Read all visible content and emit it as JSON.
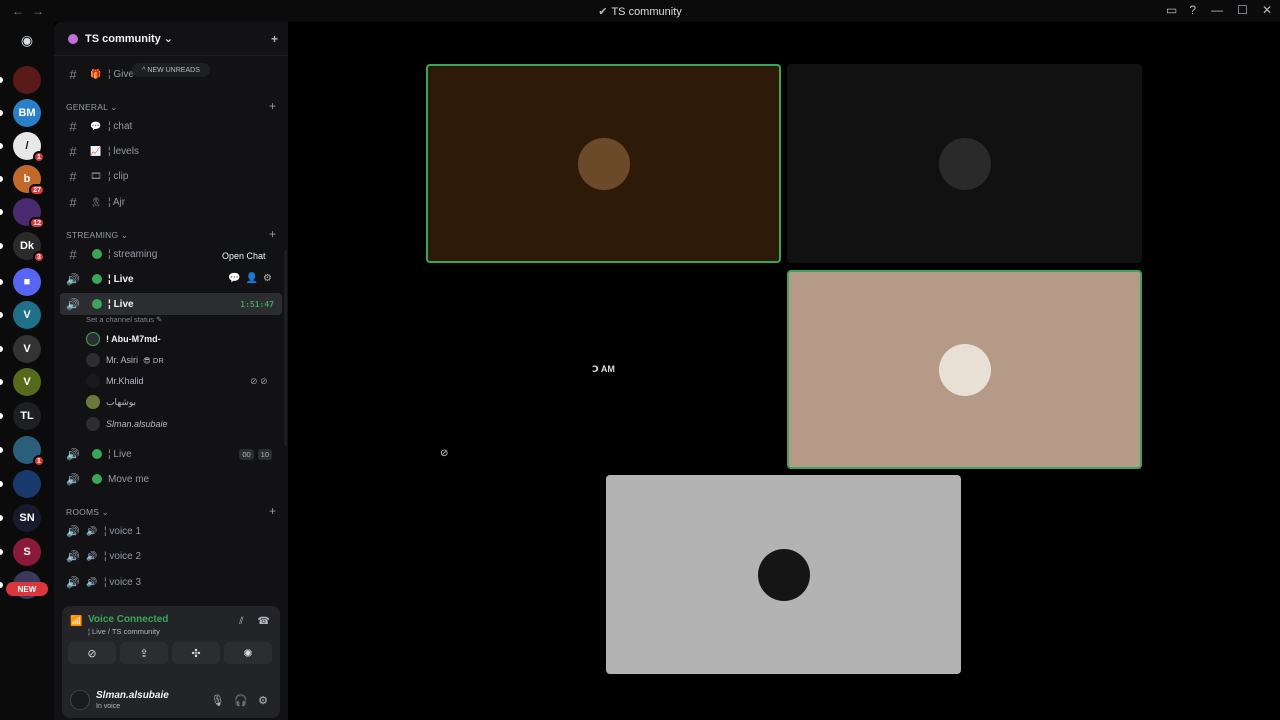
{
  "window": {
    "title": "TS community",
    "nav_back": "←",
    "nav_forward": "→",
    "title_icon": "✔",
    "inbox_icon": "▭",
    "help_icon": "?",
    "minimize": "—",
    "maximize": "☐",
    "close": "✕"
  },
  "server_rail": {
    "home_icon": "◉",
    "servers": [
      {
        "label": "",
        "badge": "",
        "color": "#5b1a1a"
      },
      {
        "label": "BM",
        "badge": "",
        "color": "#2a7fc8"
      },
      {
        "label": "/",
        "badge": "1",
        "color": "#e8e8e8"
      },
      {
        "label": "b",
        "badge": "27",
        "color": "#c0692a"
      },
      {
        "label": "",
        "badge": "12",
        "color": "#4a2a6e"
      },
      {
        "label": "Dk",
        "badge": "3",
        "color": "#2a2a2a"
      },
      {
        "label": "■",
        "badge": "",
        "color": "#5865f2"
      },
      {
        "label": "V",
        "badge": "",
        "color": "#1d6f8a"
      },
      {
        "label": "V",
        "badge": "",
        "color": "#333"
      },
      {
        "label": "V",
        "badge": "",
        "color": "#556b1a"
      },
      {
        "label": "TL",
        "badge": "",
        "color": "#1e1f22"
      },
      {
        "label": "",
        "badge": "1",
        "color": "#2a5e7a"
      },
      {
        "label": "",
        "badge": "",
        "color": "#1a3a6e"
      },
      {
        "label": "SN",
        "badge": "",
        "color": "#1a1a2e"
      },
      {
        "label": "S",
        "badge": "",
        "color": "#8a1a3a"
      },
      {
        "label": "",
        "badge": "",
        "color": "#3a3a5e"
      }
    ],
    "new_label": "NEW"
  },
  "guild": {
    "name": "TS community",
    "chevron": "⌄",
    "add_user_icon": "+",
    "new_unreads": "^ NEW UNREADS"
  },
  "channels": {
    "top": {
      "name": "¦ Give",
      "emoji": "🎁"
    },
    "general": {
      "label": "GENERAL ⌄",
      "items": [
        {
          "name": "¦ chat",
          "emoji": "💬"
        },
        {
          "name": "¦ levels",
          "emoji": "📈"
        },
        {
          "name": "¦ clip",
          "emoji": "🎞"
        },
        {
          "name": "¦ Ajr",
          "emoji": "🎗"
        }
      ]
    },
    "streaming": {
      "label": "STREAMING ⌄",
      "items": [
        {
          "name": "¦ streaming"
        },
        {
          "name": "¦ Live"
        },
        {
          "name": "¦ Live",
          "timer": "1:51:47",
          "status": "Set a channel status ✎"
        },
        {
          "name": "¦ Live",
          "count_a": "00",
          "count_b": "10"
        },
        {
          "name": "Move me"
        }
      ],
      "members": [
        {
          "name": "! Abu-M7md-",
          "tag": ""
        },
        {
          "name": "Mr. Asiri",
          "tag": "😎 DR"
        },
        {
          "name": "Mr.Khalid",
          "tag": ""
        },
        {
          "name": "بوشهاب",
          "tag": ""
        },
        {
          "name": "Slman.alsubaie",
          "tag": ""
        }
      ]
    },
    "rooms": {
      "label": "ROOMS ⌄",
      "items": [
        {
          "name": "¦ voice 1"
        },
        {
          "name": "¦ voice 2"
        },
        {
          "name": "¦ voice 3"
        }
      ]
    }
  },
  "tooltip": "Open Chat",
  "voice": {
    "status": "Voice Connected",
    "channel": "¦ Live / TS community",
    "signal_icon": "📶",
    "noise_icon": "⫽",
    "disconnect_icon": "☎",
    "buttons": [
      "⊘",
      "⇪",
      "✣",
      "✺"
    ]
  },
  "user": {
    "name": "Slman.alsubaie",
    "status": "In voice",
    "mic_icon": "🎙",
    "headset_icon": "🎧",
    "settings_icon": "⚙"
  },
  "stage": {
    "tiles": [
      {
        "name": "tile-1",
        "bg": "#2e1a08",
        "speaking": true,
        "avatar": "#6b4a2a"
      },
      {
        "name": "tile-2",
        "bg": "#111111",
        "speaking": false,
        "avatar": "#2a2a2a"
      },
      {
        "name": "tile-3",
        "bg": "#000000",
        "speaking": false,
        "avatar": "",
        "label": "Ↄ AM",
        "muted_icon": "⊘"
      },
      {
        "name": "tile-4",
        "bg": "#b59a88",
        "speaking": true,
        "avatar": "#e8e0d4"
      },
      {
        "name": "tile-5",
        "bg": "#b3b3b3",
        "speaking": false,
        "avatar": "#151515"
      }
    ]
  }
}
